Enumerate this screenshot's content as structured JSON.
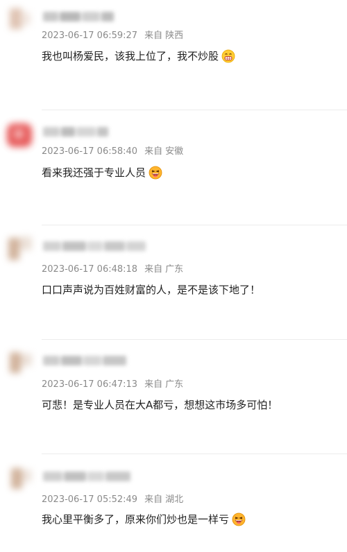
{
  "comments": [
    {
      "author": "",
      "timestamp": "2023-06-17 06:59:27",
      "from_label": "来自",
      "region": "陕西",
      "text": "我也叫杨爱民，该我上位了，我不炒股",
      "emoji": "grinning-teeth-emoji",
      "avatar_color": "#d9b8a4"
    },
    {
      "author": "",
      "timestamp": "2023-06-17 06:58:40",
      "from_label": "来自",
      "region": "安徽",
      "text": "看来我还强于专业人员",
      "emoji": "laughing-emoji",
      "avatar_color": "#e23b3b"
    },
    {
      "author": "",
      "timestamp": "2023-06-17 06:48:18",
      "from_label": "来自",
      "region": "广东",
      "text": "口口声声说为百姓财富的人，是不是该下地了！",
      "emoji": "",
      "avatar_color": "#c9a58a"
    },
    {
      "author": "",
      "timestamp": "2023-06-17 06:47:13",
      "from_label": "来自",
      "region": "广东",
      "text": "可悲！是专业人员在大A都亏，想想这市场多可怕！",
      "emoji": "",
      "avatar_color": "#c9a58a"
    },
    {
      "author": "",
      "timestamp": "2023-06-17 05:52:49",
      "from_label": "来自",
      "region": "湖北",
      "text": "我心里平衡多了，原来你们炒也是一样亏",
      "emoji": "laughing-emoji",
      "avatar_color": "#c9a58a"
    }
  ]
}
